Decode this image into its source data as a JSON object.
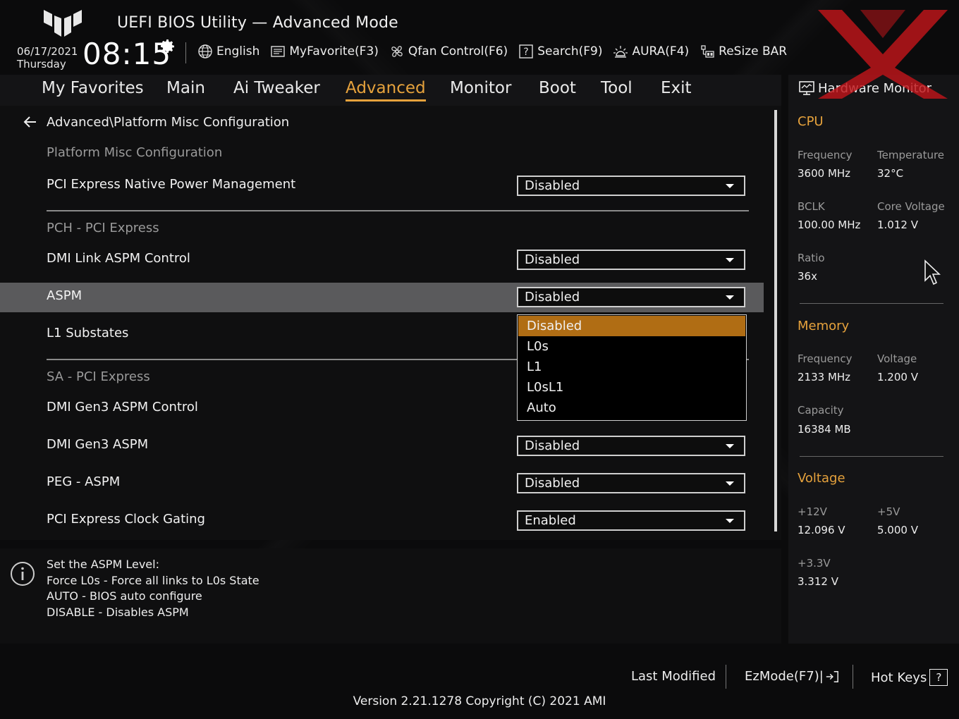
{
  "header": {
    "title": "UEFI BIOS Utility — Advanced Mode",
    "date": "06/17/2021",
    "day": "Thursday",
    "time": "08:15",
    "toolbar": [
      {
        "label": "English",
        "icon": "globe-icon"
      },
      {
        "label": "MyFavorite(F3)",
        "icon": "favorite-icon"
      },
      {
        "label": "Qfan Control(F6)",
        "icon": "fan-icon"
      },
      {
        "label": "Search(F9)",
        "icon": "search-icon"
      },
      {
        "label": "AURA(F4)",
        "icon": "aura-icon"
      },
      {
        "label": "ReSize BAR",
        "icon": "resize-bar-icon"
      }
    ]
  },
  "tabs": [
    "My Favorites",
    "Main",
    "Ai Tweaker",
    "Advanced",
    "Monitor",
    "Boot",
    "Tool",
    "Exit"
  ],
  "active_tab": "Advanced",
  "breadcrumb": "Advanced\\Platform Misc Configuration",
  "sections": {
    "platform": "Platform Misc Configuration",
    "pch": "PCH - PCI Express",
    "sa": "SA - PCI Express"
  },
  "settings": {
    "pci_native_pm": {
      "label": "PCI Express Native Power Management",
      "value": "Disabled"
    },
    "dmi_link_aspm": {
      "label": "DMI Link ASPM Control",
      "value": "Disabled"
    },
    "aspm": {
      "label": "ASPM",
      "value": "Disabled"
    },
    "l1_substates": {
      "label": "L1 Substates"
    },
    "dmi_gen3_aspm_control": {
      "label": "DMI Gen3 ASPM Control"
    },
    "dmi_gen3_aspm": {
      "label": "DMI Gen3 ASPM",
      "value": "Disabled"
    },
    "peg_aspm": {
      "label": "PEG - ASPM",
      "value": "Disabled"
    },
    "pci_clock_gating": {
      "label": "PCI Express Clock Gating",
      "value": "Enabled"
    }
  },
  "dropdown": {
    "options": [
      "Disabled",
      "L0s",
      "L1",
      "L0sL1",
      "Auto"
    ],
    "selected": "Disabled"
  },
  "help": [
    "Set the ASPM Level:",
    "Force L0s - Force all links to L0s State",
    "AUTO - BIOS auto configure",
    "DISABLE - Disables ASPM"
  ],
  "hardware_monitor": {
    "title": "Hardware Monitor",
    "cpu": {
      "heading": "CPU",
      "frequency_label": "Frequency",
      "frequency": "3600 MHz",
      "temperature_label": "Temperature",
      "temperature": "32°C",
      "bclk_label": "BCLK",
      "bclk": "100.00 MHz",
      "core_voltage_label": "Core Voltage",
      "core_voltage": "1.012 V",
      "ratio_label": "Ratio",
      "ratio": "36x"
    },
    "memory": {
      "heading": "Memory",
      "frequency_label": "Frequency",
      "frequency": "2133 MHz",
      "voltage_label": "Voltage",
      "voltage": "1.200 V",
      "capacity_label": "Capacity",
      "capacity": "16384 MB"
    },
    "voltage": {
      "heading": "Voltage",
      "v12_label": "+12V",
      "v12": "12.096 V",
      "v5_label": "+5V",
      "v5": "5.000 V",
      "v33_label": "+3.3V",
      "v33": "3.312 V"
    }
  },
  "footer": {
    "last_modified": "Last Modified",
    "ezmode": "EzMode(F7)|",
    "hotkeys": "Hot Keys",
    "hotkeys_badge": "?",
    "version": "Version 2.21.1278 Copyright (C) 2021 AMI"
  },
  "colors": {
    "accent": "#e6a23c",
    "selected_option": "#b06d14",
    "highlight_row": "#5a5a5c",
    "watermark": "#c0151a"
  }
}
